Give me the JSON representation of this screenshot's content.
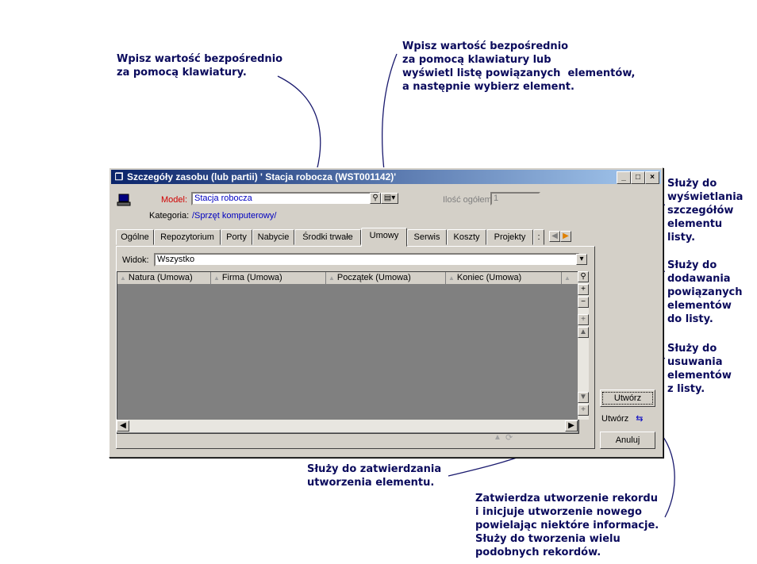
{
  "annotations": {
    "keyboard_entry": "Wpisz wartość bezpośrednio\nza pomocą klawiatury.",
    "list_entry": "Wpisz wartość bezpośrednio\nza pomocą klawiatury lub\nwyświetl listę powiązanych  elementów,\na następnie wybierz element.",
    "view_details": "Służy do\nwyświetlania\nszczegółów\nelementu\nlisty.",
    "add_items": "Służy do\ndodawania\npowiązanych\nelementów\ndo listy.",
    "remove_items": "Służy do\nusuwania\nelementów\nz listy.",
    "confirm_create": "Służy do zatwierdzania\nutworzenia elementu.",
    "duplicate_create": "Zatwierdza utworzenie rekordu\ni inicjuje utworzenie nowego\npowielając niektóre informacje.\nSłuży do tworzenia wielu\npodobnych rekordów."
  },
  "window": {
    "title": "Szczegóły zasobu (lub partii) ' Stacja robocza (WST001142)'",
    "model_label": "Model:",
    "model_value": "Stacja robocza",
    "category_label": "Kategoria:",
    "category_value": "/Sprzęt komputerowy/",
    "quantity_label": "Ilość ogółem:",
    "quantity_value": "1",
    "tabs": [
      "Ogólne",
      "Repozytorium",
      "Porty",
      "Nabycie",
      "Środki trwałe",
      "Umowy",
      "Serwis",
      "Koszty",
      "Projekty"
    ],
    "view_label": "Widok:",
    "view_value": "Wszystko",
    "columns": [
      "Natura (Umowa)",
      "Firma (Umowa)",
      "Początek (Umowa)",
      "Koniec (Umowa)"
    ],
    "create_button": "Utwórz",
    "create_dup_button": "Utwórz",
    "cancel_button": "Anuluj"
  },
  "colors": {
    "title_bar": "#0a246a",
    "model_label": "#d00000",
    "link_text": "#0000c0",
    "annotation_text": "#0a0a5c"
  }
}
